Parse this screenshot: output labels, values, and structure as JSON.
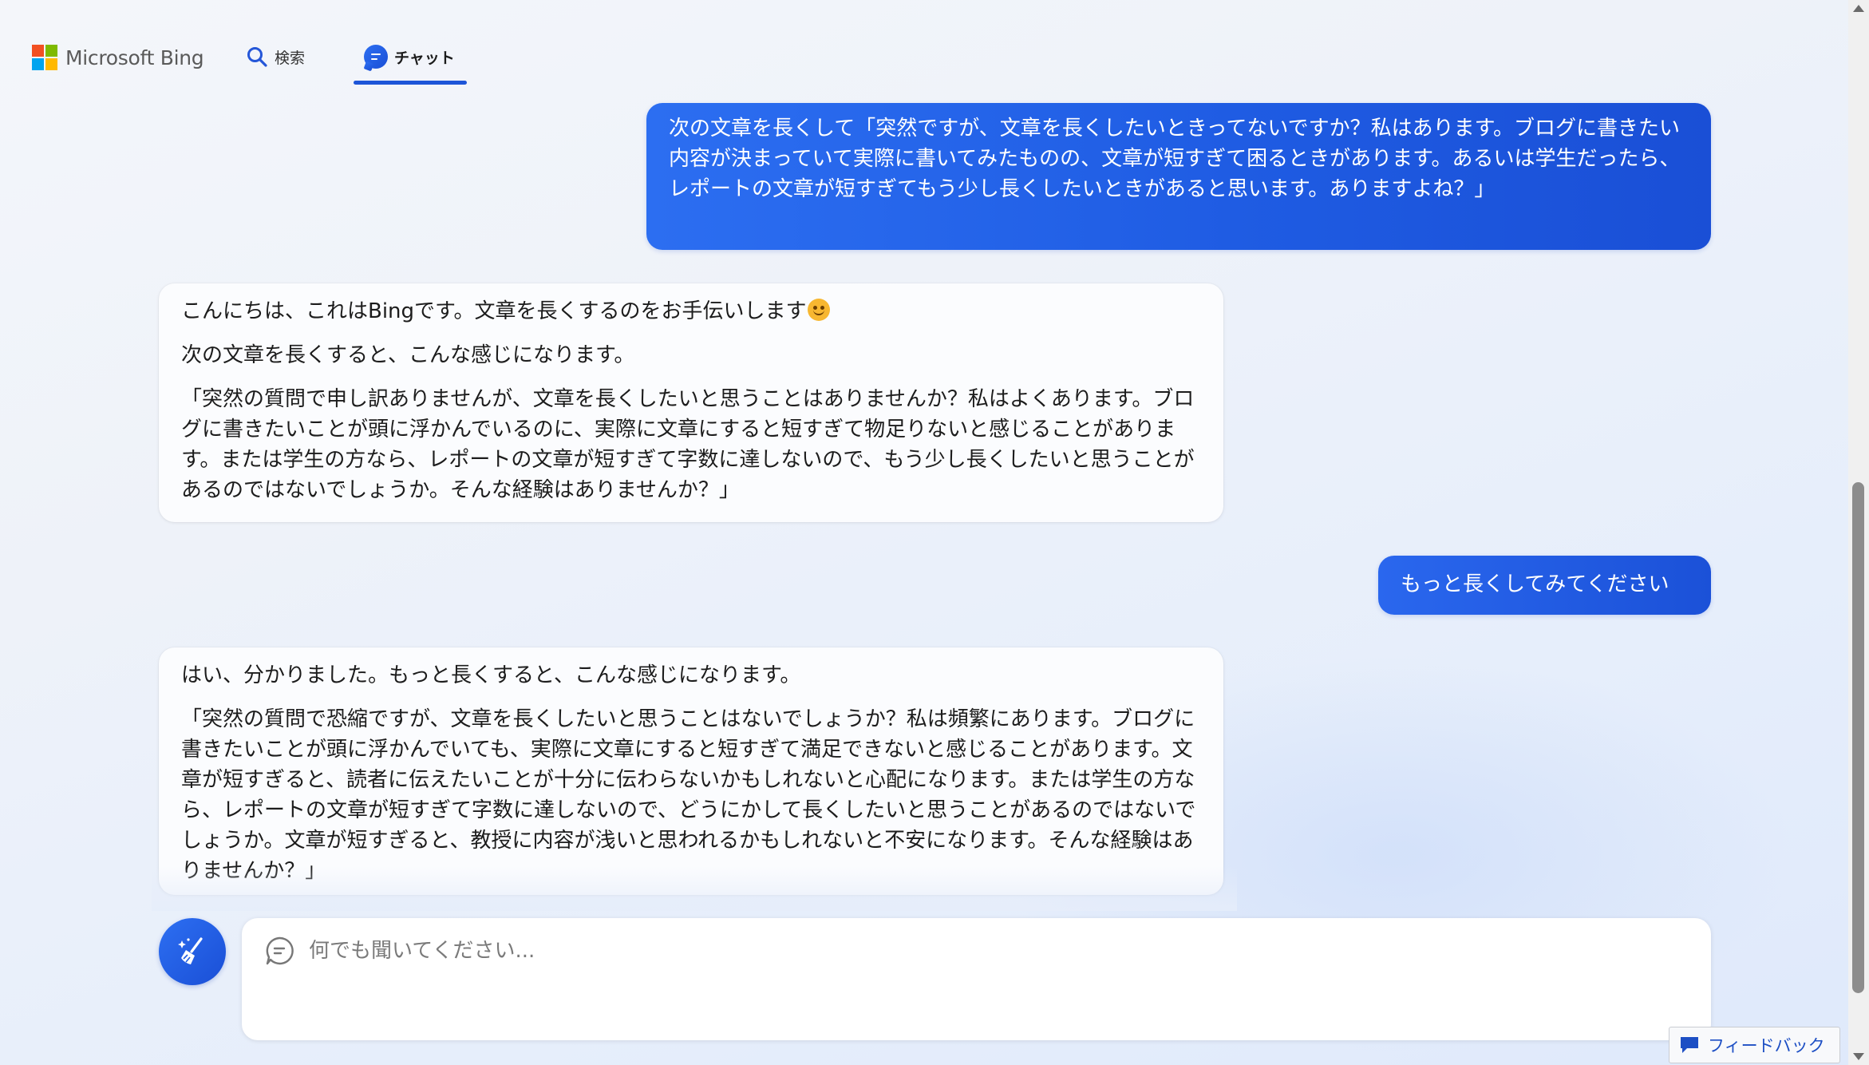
{
  "brand": {
    "name": "Microsoft Bing",
    "logo_colors": [
      "#f25022",
      "#7fba00",
      "#00a4ef",
      "#ffb900"
    ]
  },
  "nav": {
    "tabs": [
      {
        "label": "検索",
        "icon": "search-icon",
        "active": false
      },
      {
        "label": "チャット",
        "icon": "chat-bubble-icon",
        "active": true
      }
    ]
  },
  "conversation": {
    "messages": [
      {
        "role": "user",
        "text": "次の文章を長くして「突然ですが、文章を長くしたいときってないですか？私はあります。ブログに書きたい内容が決まっていて実際に書いてみたものの、文章が短すぎて困るときがあります。あるいは学生だったら、レポートの文章が短すぎてもう少し長くしたいときがあると思います。ありますよね？」"
      },
      {
        "role": "bot",
        "paragraphs": [
          "こんにちは、これはBingです。文章を長くするのをお手伝いします",
          "次の文章を長くすると、こんな感じになります。",
          "「突然の質問で申し訳ありませんが、文章を長くしたいと思うことはありませんか？私はよくあります。ブログに書きたいことが頭に浮かんでいるのに、実際に文章にすると短すぎて物足りないと感じることがあります。または学生の方なら、レポートの文章が短すぎて字数に達しないので、もう少し長くしたいと思うことがあるのではないでしょうか。そんな経験はありませんか？」"
        ],
        "emoji": "smiling-face-emoji"
      },
      {
        "role": "user",
        "text": "もっと長くしてみてください"
      },
      {
        "role": "bot",
        "paragraphs": [
          "はい、分かりました。もっと長くすると、こんな感じになります。",
          "「突然の質問で恐縮ですが、文章を長くしたいと思うことはないでしょうか？私は頻繁にあります。ブログに書きたいことが頭に浮かんでいても、実際に文章にすると短すぎて満足できないと感じることがあります。文章が短すぎると、読者に伝えたいことが十分に伝わらないかもしれないと心配になります。または学生の方なら、レポートの文章が短すぎて字数に達しないので、どうにかして長くしたいと思うことがあるのではないでしょうか。文章が短すぎると、教授に内容が浅いと思われるかもしれないと不安になります。そんな経験はありませんか？」"
        ]
      }
    ]
  },
  "composer": {
    "placeholder": "何でも聞いてください...",
    "value": "",
    "new_topic_icon": "broom-sparkle-icon"
  },
  "feedback": {
    "label": "フィードバック",
    "icon": "feedback-icon"
  },
  "colors": {
    "user_bubble_start": "#2b6cf0",
    "user_bubble_end": "#1a4fd6",
    "accent": "#1d55d8",
    "search_icon": "#2456d8"
  }
}
